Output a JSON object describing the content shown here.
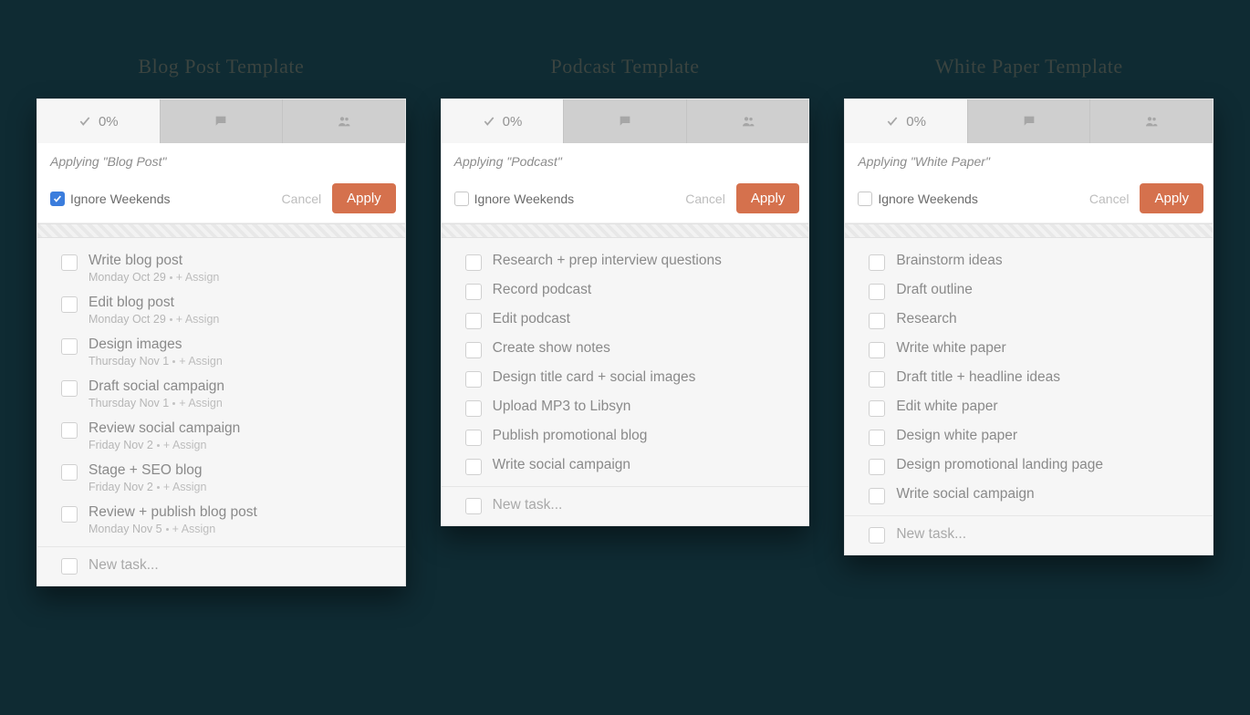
{
  "colors": {
    "accent": "#d5714d",
    "checkbox_checked": "#3b7ddd"
  },
  "common": {
    "progress_label": "0%",
    "cancel_label": "Cancel",
    "apply_label": "Apply",
    "ignore_label": "Ignore Weekends",
    "assign_label": "+ Assign",
    "new_task_label": "New task..."
  },
  "panels": [
    {
      "title": "Blog Post Template",
      "applying_text": "Applying \"Blog Post\"",
      "ignore_checked": true,
      "tasks": [
        {
          "title": "Write blog post",
          "date": "Monday Oct 29"
        },
        {
          "title": "Edit blog post",
          "date": "Monday Oct 29"
        },
        {
          "title": "Design images",
          "date": "Thursday Nov 1"
        },
        {
          "title": "Draft social campaign",
          "date": "Thursday Nov 1"
        },
        {
          "title": "Review social campaign",
          "date": "Friday Nov 2"
        },
        {
          "title": "Stage + SEO blog",
          "date": "Friday Nov 2"
        },
        {
          "title": "Review + publish blog post",
          "date": "Monday Nov 5"
        }
      ]
    },
    {
      "title": "Podcast Template",
      "applying_text": "Applying \"Podcast\"",
      "ignore_checked": false,
      "tasks": [
        {
          "title": "Research + prep interview questions"
        },
        {
          "title": "Record podcast"
        },
        {
          "title": "Edit podcast"
        },
        {
          "title": "Create show notes"
        },
        {
          "title": "Design title card + social images"
        },
        {
          "title": "Upload MP3 to Libsyn"
        },
        {
          "title": "Publish promotional blog"
        },
        {
          "title": "Write social campaign"
        }
      ]
    },
    {
      "title": "White Paper Template",
      "applying_text": "Applying \"White Paper\"",
      "ignore_checked": false,
      "tasks": [
        {
          "title": "Brainstorm ideas"
        },
        {
          "title": "Draft outline"
        },
        {
          "title": "Research"
        },
        {
          "title": "Write white paper"
        },
        {
          "title": "Draft title + headline ideas"
        },
        {
          "title": "Edit white paper"
        },
        {
          "title": "Design white paper"
        },
        {
          "title": "Design promotional landing page"
        },
        {
          "title": "Write social campaign"
        }
      ]
    }
  ]
}
